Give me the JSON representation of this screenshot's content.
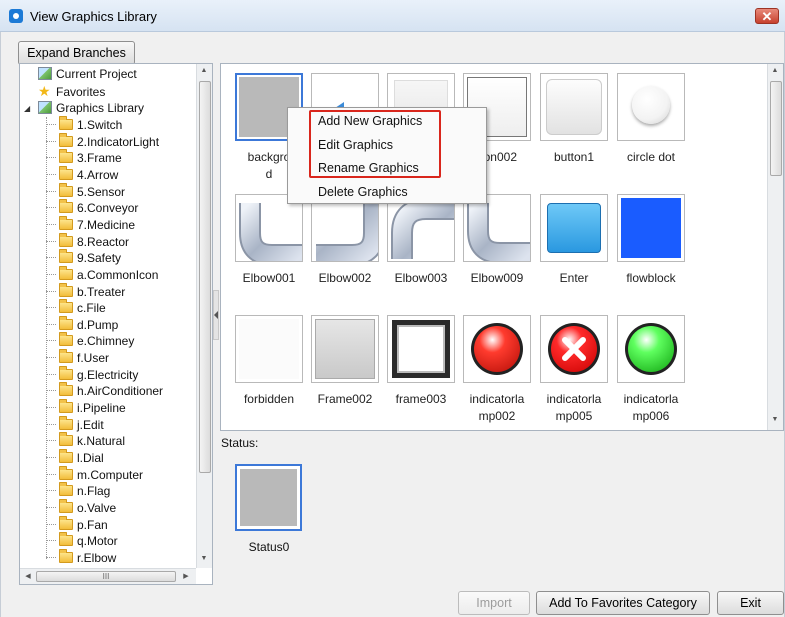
{
  "window": {
    "title": "View Graphics Library",
    "close_glyph": "✕"
  },
  "toolbar": {
    "expand_branches": "Expand Branches"
  },
  "tree": {
    "current_project": "Current Project",
    "favorites": "Favorites",
    "graphics_library": "Graphics Library",
    "folders": [
      "1.Switch",
      "2.IndicatorLight",
      "3.Frame",
      "4.Arrow",
      "5.Sensor",
      "6.Conveyor",
      "7.Medicine",
      "8.Reactor",
      "9.Safety",
      "a.CommonIcon",
      "b.Treater",
      "c.File",
      "d.Pump",
      "e.Chimney",
      "f.User",
      "g.Electricity",
      "h.AirConditioner",
      "i.Pipeline",
      "j.Edit",
      "k.Natural",
      "l.Dial",
      "m.Computer",
      "n.Flag",
      "o.Valve",
      "p.Fan",
      "q.Motor",
      "r.Elbow"
    ],
    "hscroll_grip": "III"
  },
  "gallery": {
    "items": [
      {
        "label": "backgro\nd",
        "kind": "gray"
      },
      {
        "label": "",
        "kind": "arrow"
      },
      {
        "label": "",
        "kind": "plain"
      },
      {
        "label": "tton002",
        "kind": "button-outline"
      },
      {
        "label": "button1",
        "kind": "button-soft"
      },
      {
        "label": "circle dot",
        "kind": "circle"
      },
      {
        "label": "Elbow001",
        "kind": "elbow-a"
      },
      {
        "label": "Elbow002",
        "kind": "elbow-b"
      },
      {
        "label": "Elbow003",
        "kind": "elbow-c"
      },
      {
        "label": "Elbow009",
        "kind": "elbow-d"
      },
      {
        "label": "Enter",
        "kind": "enter"
      },
      {
        "label": "flowblock",
        "kind": "flowblock"
      },
      {
        "label": "forbidden",
        "kind": "forbidden"
      },
      {
        "label": "Frame002",
        "kind": "frame2"
      },
      {
        "label": "frame003",
        "kind": "frame3"
      },
      {
        "label": "indicatorla\nmp002",
        "kind": "lamp-red"
      },
      {
        "label": "indicatorla\nmp005",
        "kind": "lamp-x"
      },
      {
        "label": "indicatorla\nmp006",
        "kind": "lamp-green"
      }
    ]
  },
  "context_menu": {
    "items": [
      "Add New Graphics",
      "Edit Graphics",
      "Rename Graphics",
      "Delete Graphics"
    ]
  },
  "status": {
    "label": "Status:",
    "item_name": "Status0"
  },
  "footer": {
    "import": "Import",
    "add_favorites": "Add To Favorites Category",
    "exit": "Exit"
  },
  "colors": {
    "selection": "#3c78d8",
    "highlight": "#d9261c",
    "flowblock": "#1a5cff",
    "enter": "#2a98e0"
  }
}
